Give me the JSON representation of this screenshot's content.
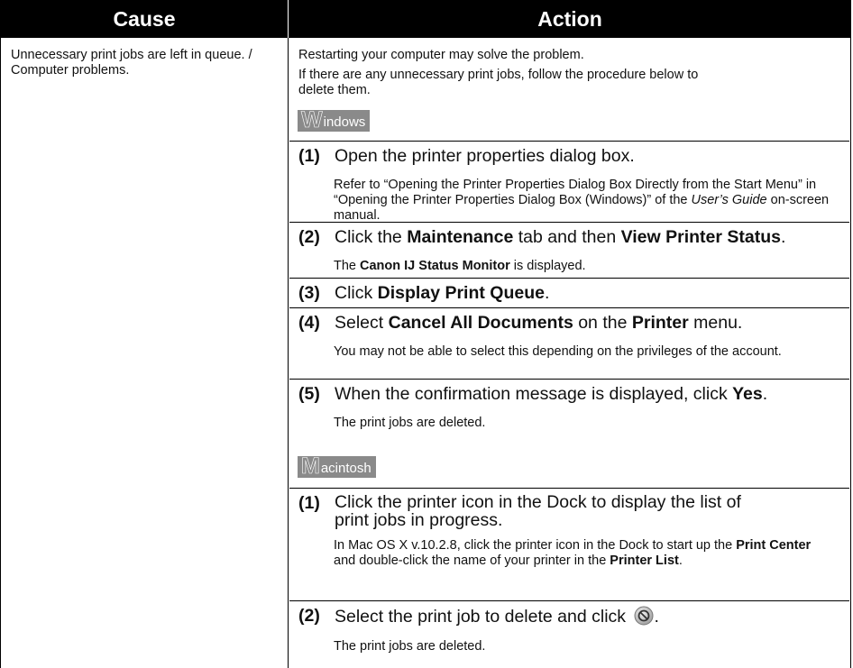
{
  "header": {
    "cause": "Cause",
    "action": "Action"
  },
  "cause": {
    "text": "Unnecessary print jobs are left in queue. / Computer problems."
  },
  "intro": {
    "line1": "Restarting your computer may solve the problem.",
    "line2": "If there are any unnecessary print jobs, follow the procedure below to delete them."
  },
  "windows": {
    "badge_initial": "W",
    "badge_rest": "indows",
    "steps": [
      {
        "num": "(1)",
        "text": "Open the printer properties dialog box."
      },
      {
        "num": "(2)",
        "pre": "Click the ",
        "b1": "Maintenance",
        "mid": " tab and then ",
        "b2": "View Printer Status",
        "post": "."
      },
      {
        "num": "(3)",
        "pre": "Click ",
        "b1": "Display Print Queue",
        "post": "."
      },
      {
        "num": "(4)",
        "pre": "Select ",
        "b1": "Cancel All Documents",
        "mid": " on the ",
        "b2": "Printer",
        "post": " menu."
      },
      {
        "num": "(5)",
        "pre": "When the confirmation message is displayed, click ",
        "b1": "Yes",
        "post": "."
      }
    ],
    "note1": {
      "pre": "Refer to “Opening the Printer Properties Dialog Box Directly from the Start Menu” in “Opening the Printer Properties Dialog Box (Windows)” of the ",
      "italic": "User’s Guide",
      "post": " on-screen manual."
    },
    "note2": {
      "pre": "The ",
      "bold": "Canon IJ Status Monitor",
      "post": " is displayed."
    },
    "note4": "You may not be able to select this depending on the privileges of the account.",
    "note5": "The print jobs are deleted."
  },
  "mac": {
    "badge_initial": "M",
    "badge_rest": "acintosh",
    "steps": [
      {
        "num": "(1)",
        "text": "Click the printer icon in the Dock to display the list of print jobs in progress."
      },
      {
        "num": "(2)",
        "text": "Select the print job to delete and click",
        "post": "."
      }
    ],
    "note1": {
      "pre": "In Mac OS X v.10.2.8, click the printer icon in the Dock to start up the ",
      "b1": "Print Center",
      "mid": " and double-click the name of your printer in the ",
      "b2": "Printer List",
      "post": "."
    },
    "note2": "The print jobs are deleted.",
    "delete_icon": "delete-job-icon"
  }
}
